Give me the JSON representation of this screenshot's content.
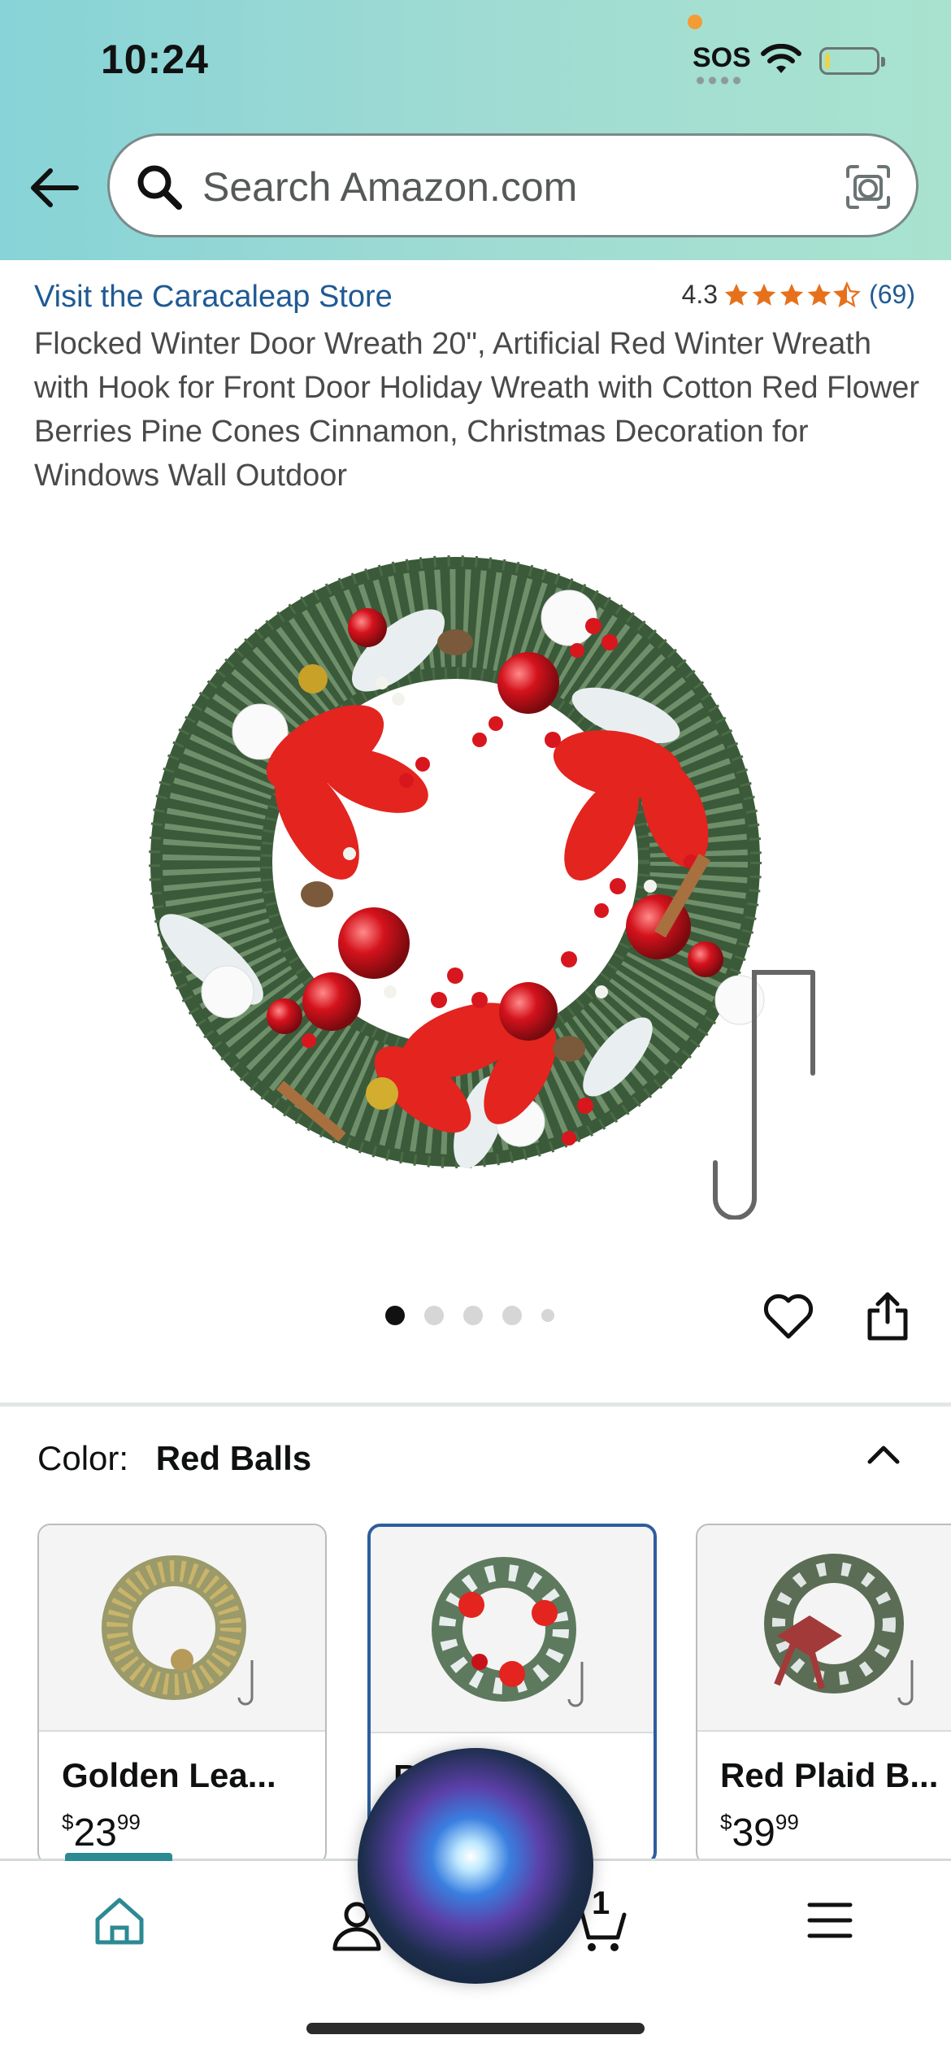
{
  "status_bar": {
    "time": "10:24",
    "sos": "SOS"
  },
  "search": {
    "placeholder": "Search Amazon.com"
  },
  "product": {
    "store_link": "Visit the Caracaleap Store",
    "rating_value": "4.3",
    "rating_count": "(69)",
    "stars_filled": 4.3,
    "title": "Flocked Winter Door Wreath 20\", Artificial Red Winter Wreath with Hook for Front Door Holiday Wreath with Cotton Red Flower Berries Pine Cones Cinnamon, Christmas Decoration for Windows Wall Outdoor",
    "image_count": 5,
    "active_image_index": 0
  },
  "color_section": {
    "label": "Color:",
    "selected": "Red Balls",
    "options": [
      {
        "name": "Golden Lea...",
        "price_symbol": "$",
        "price_whole": "23",
        "price_fraction": "99"
      },
      {
        "name": "R",
        "price_symbol": "",
        "price_whole": "",
        "price_fraction": ""
      },
      {
        "name": "Red Plaid B...",
        "price_symbol": "$",
        "price_whole": "39",
        "price_fraction": "99"
      }
    ]
  },
  "bottom_nav": {
    "cart_count": "1"
  },
  "colors": {
    "header_gradient_start": "#87d3d7",
    "header_gradient_end": "#a9e3cf",
    "link": "#1f5a94",
    "star": "#e7711b",
    "selected_border": "#2d5d9e",
    "nav_active": "#2c8a93"
  }
}
